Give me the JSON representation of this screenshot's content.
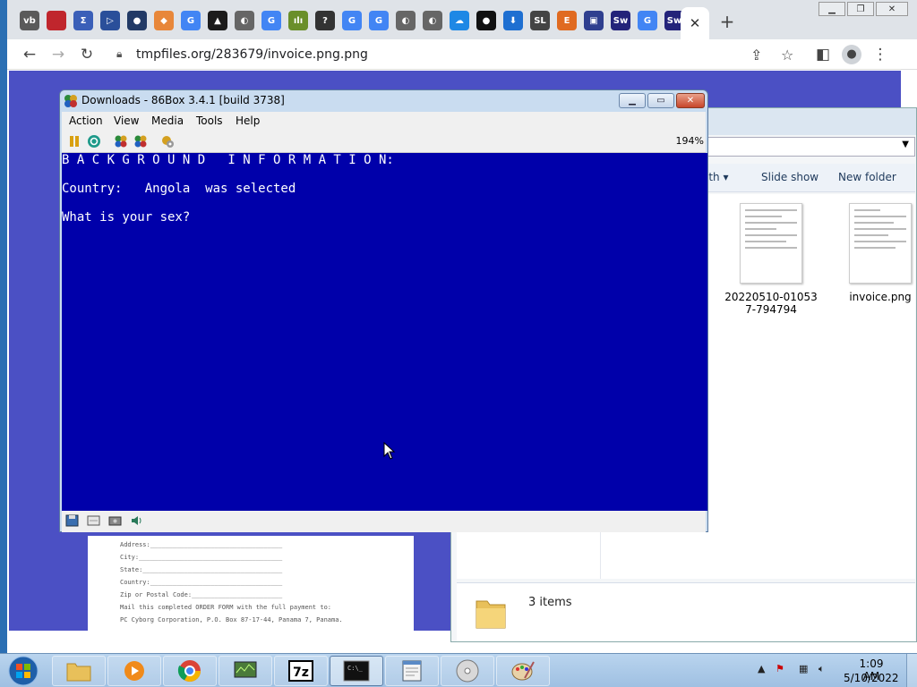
{
  "browser": {
    "url": "tmpfiles.org/283679/invoice.png.png",
    "tabs": [
      {
        "icon": "vb-favicon-icon",
        "text": "vb",
        "color": "#5a5a5a"
      },
      {
        "icon": "red-square-favicon-icon",
        "text": "",
        "color": "#c0262d"
      },
      {
        "icon": "sigma-favicon-icon",
        "text": "Σ",
        "color": "#3a5fb8"
      },
      {
        "icon": "play-favicon-icon",
        "text": "▷",
        "color": "#2a4f9a"
      },
      {
        "icon": "globe-dark-favicon-icon",
        "text": "●",
        "color": "#223a66"
      },
      {
        "icon": "diamond-favicon-icon",
        "text": "◆",
        "color": "#e8873a"
      },
      {
        "icon": "google-favicon-icon",
        "text": "G",
        "color": "#4285f4"
      },
      {
        "icon": "triangle-favicon-icon",
        "text": "▲",
        "color": "#1c1c1c"
      },
      {
        "icon": "globe-favicon-icon",
        "text": "◐",
        "color": "#666666"
      },
      {
        "icon": "google-favicon-icon",
        "text": "G",
        "color": "#4285f4"
      },
      {
        "icon": "chart-favicon-icon",
        "text": "ılı",
        "color": "#6a8f2a"
      },
      {
        "icon": "question-favicon-icon",
        "text": "?",
        "color": "#333333"
      },
      {
        "icon": "google-favicon-icon",
        "text": "G",
        "color": "#4285f4"
      },
      {
        "icon": "google-favicon-icon",
        "text": "G",
        "color": "#4285f4"
      },
      {
        "icon": "globe-favicon-icon",
        "text": "◐",
        "color": "#666666"
      },
      {
        "icon": "globe-favicon-icon",
        "text": "◐",
        "color": "#666666"
      },
      {
        "icon": "cloud-favicon-icon",
        "text": "☁",
        "color": "#1e88e5"
      },
      {
        "icon": "github-favicon-icon",
        "text": "●",
        "color": "#111111"
      },
      {
        "icon": "download-favicon-icon",
        "text": "⬇",
        "color": "#1e6fd1"
      },
      {
        "icon": "sl-favicon-icon",
        "text": "SL",
        "color": "#444444"
      },
      {
        "icon": "e-favicon-icon",
        "text": "E",
        "color": "#e06a20"
      },
      {
        "icon": "floppy-favicon-icon",
        "text": "▣",
        "color": "#2f3f8f"
      },
      {
        "icon": "sw-favicon-icon",
        "text": "Sw",
        "color": "#23237a"
      },
      {
        "icon": "google-favicon-icon",
        "text": "G",
        "color": "#4285f4"
      },
      {
        "icon": "sw-favicon-icon",
        "text": "Sw",
        "color": "#23237a"
      }
    ],
    "active_tab_close": "✕",
    "new_tab": "+"
  },
  "invoice_paper": {
    "lines": [
      "Address:___________________________________",
      "City:______________________________________",
      "State:_____________________________________",
      "Country:___________________________________",
      "Zip or Postal Code:________________________",
      "Mail this completed ORDER FORM with the full payment to:",
      "PC Cyborg Corporation, P.O. Box 87-17-44, Panama 7, Panama."
    ]
  },
  "explorer": {
    "commands": [
      "ith ▾",
      "Slide show",
      "New folder"
    ],
    "files": [
      {
        "name": "20220510-010537-794794"
      },
      {
        "name": "invoice.png"
      }
    ],
    "status": "3 items"
  },
  "box86": {
    "title": "Downloads - 86Box 3.4.1 [build 3738]",
    "menu": [
      "Action",
      "View",
      "Media",
      "Tools",
      "Help"
    ],
    "zoom": "194%",
    "screen_lines": [
      "B A C K G R O U N D   I N F O R M A T I O N:",
      "Country:   Angola  was selected",
      "What is your sex?"
    ]
  },
  "taskbar": {
    "time": "1:09 AM",
    "date": "5/10/2022",
    "buttons": [
      "explorer",
      "media-player",
      "chrome",
      "system-monitor",
      "7zip",
      "cmd",
      "notepad",
      "disc",
      "paint"
    ]
  }
}
